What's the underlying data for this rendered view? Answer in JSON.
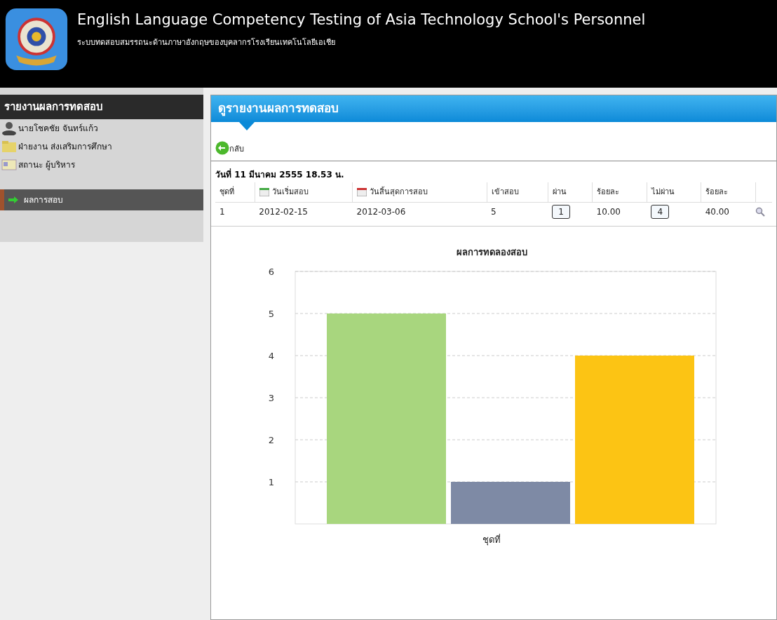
{
  "header": {
    "title": "English Language Competency Testing of Asia Technology School's Personnel",
    "subtitle": "ระบบทดสอบสมรรถนะด้านภาษาอังกฤษของบุคลากรโรงเรียนเทคโนโลยีเอเชีย"
  },
  "sidebar": {
    "title": "รายงานผลการทดสอบ",
    "user": [
      {
        "kind": "person",
        "text": "นายโชคชัย จันทร์แก้ว"
      },
      {
        "kind": "department",
        "text": "ฝ่ายงาน ส่งเสริมการศึกษา"
      },
      {
        "kind": "role",
        "text": "สถานะ ผู้บริหาร"
      }
    ],
    "menu": [
      {
        "label": "ผลการสอบ",
        "selected": true
      }
    ]
  },
  "page": {
    "title": "ดูรายงานผลการทดสอบ",
    "back": "กลับ",
    "date": "วันที่ 11 มีนาคม 2555 18.53 น.",
    "table": {
      "columns": [
        {
          "label": "ชุดที่"
        },
        {
          "label": "วันเริ่มสอบ"
        },
        {
          "label": "วันสิ้นสุดการสอบ"
        },
        {
          "label": "เข้าสอบ"
        },
        {
          "label": "ผ่าน"
        },
        {
          "label": "ร้อยละ"
        },
        {
          "label": "ไม่ผ่าน"
        },
        {
          "label": "ร้อยละ"
        }
      ],
      "rows": [
        [
          "1",
          "2012-02-15",
          "2012-03-06",
          "5",
          "1",
          "10.00",
          "4",
          "40.00"
        ]
      ]
    },
    "chart_data": {
      "type": "bar",
      "title": "ผลการทดลองสอบ",
      "xlabel": "ชุดที่",
      "ylim": [
        0,
        6
      ],
      "grid": true,
      "yticks": [
        1,
        2,
        3,
        4,
        5,
        6
      ],
      "series": [
        {
          "color": "#a8d67e",
          "values": [
            5
          ]
        },
        {
          "color": "#7e8aa5",
          "values": [
            1
          ]
        },
        {
          "color": "#fcc414",
          "values": [
            4
          ]
        }
      ]
    }
  }
}
